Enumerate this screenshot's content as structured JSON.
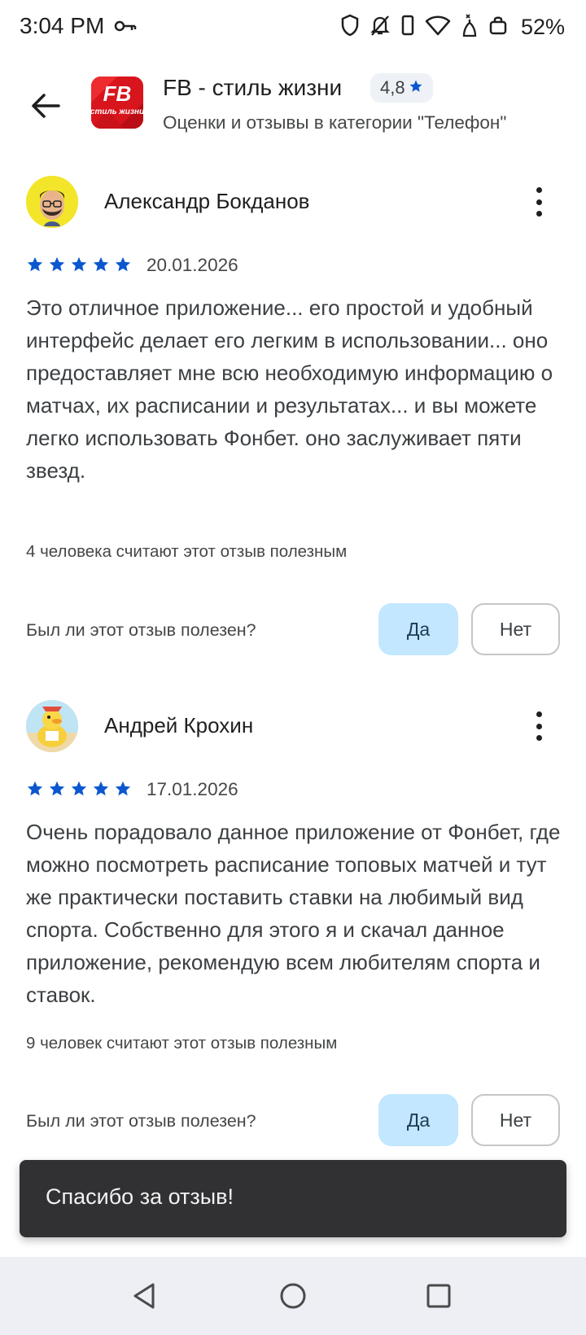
{
  "status_bar": {
    "time": "3:04 PM",
    "battery_percent": "52%",
    "icons": [
      "key-icon",
      "shield-icon",
      "bell-off-icon",
      "vibrate-icon",
      "wifi-icon",
      "signal-off-icon",
      "bag-icon"
    ]
  },
  "header": {
    "app_name": "FB - стиль жизни",
    "rating": "4,8",
    "subtitle": "Оценки и отзывы в категории \"Телефон\"",
    "app_icon_text_top": "FB",
    "app_icon_text_bottom": "стиль жизни"
  },
  "reviews": [
    {
      "author": "Александр Бокданов",
      "stars": 5,
      "date": "20.01.2026",
      "text": "Это отличное приложение... его простой и удобный интерфейс делает его легким в использовании... оно предоставляет мне всю необходимую информацию о матчах, их расписании и результатах... и вы можете легко использовать Фонбет. оно заслуживает пяти звезд.",
      "helpful_count": "4 человека считают этот отзыв полезным",
      "helpful_question": "Был ли этот отзыв полезен?",
      "yes_label": "Да",
      "no_label": "Нет"
    },
    {
      "author": "Андрей Крохин",
      "stars": 5,
      "date": "17.01.2026",
      "text": "Очень порадовало данное приложение от Фонбет, где можно посмотреть расписание топовых матчей и тут же практически поставить ставки на любимый вид спорта. Собственно для этого я и скачал данное приложение, рекомендую всем любителям спорта и ставок.",
      "helpful_count": "9 человек считают этот отзыв полезным",
      "helpful_question": "Был ли этот отзыв полезен?",
      "yes_label": "Да",
      "no_label": "Нет"
    }
  ],
  "snackbar": {
    "message": "Спасибо за отзыв!"
  },
  "colors": {
    "star": "#0b57d0",
    "yes_button_bg": "#c2e7ff",
    "snackbar_bg": "#313033",
    "app_icon_red": "#e2141c"
  }
}
